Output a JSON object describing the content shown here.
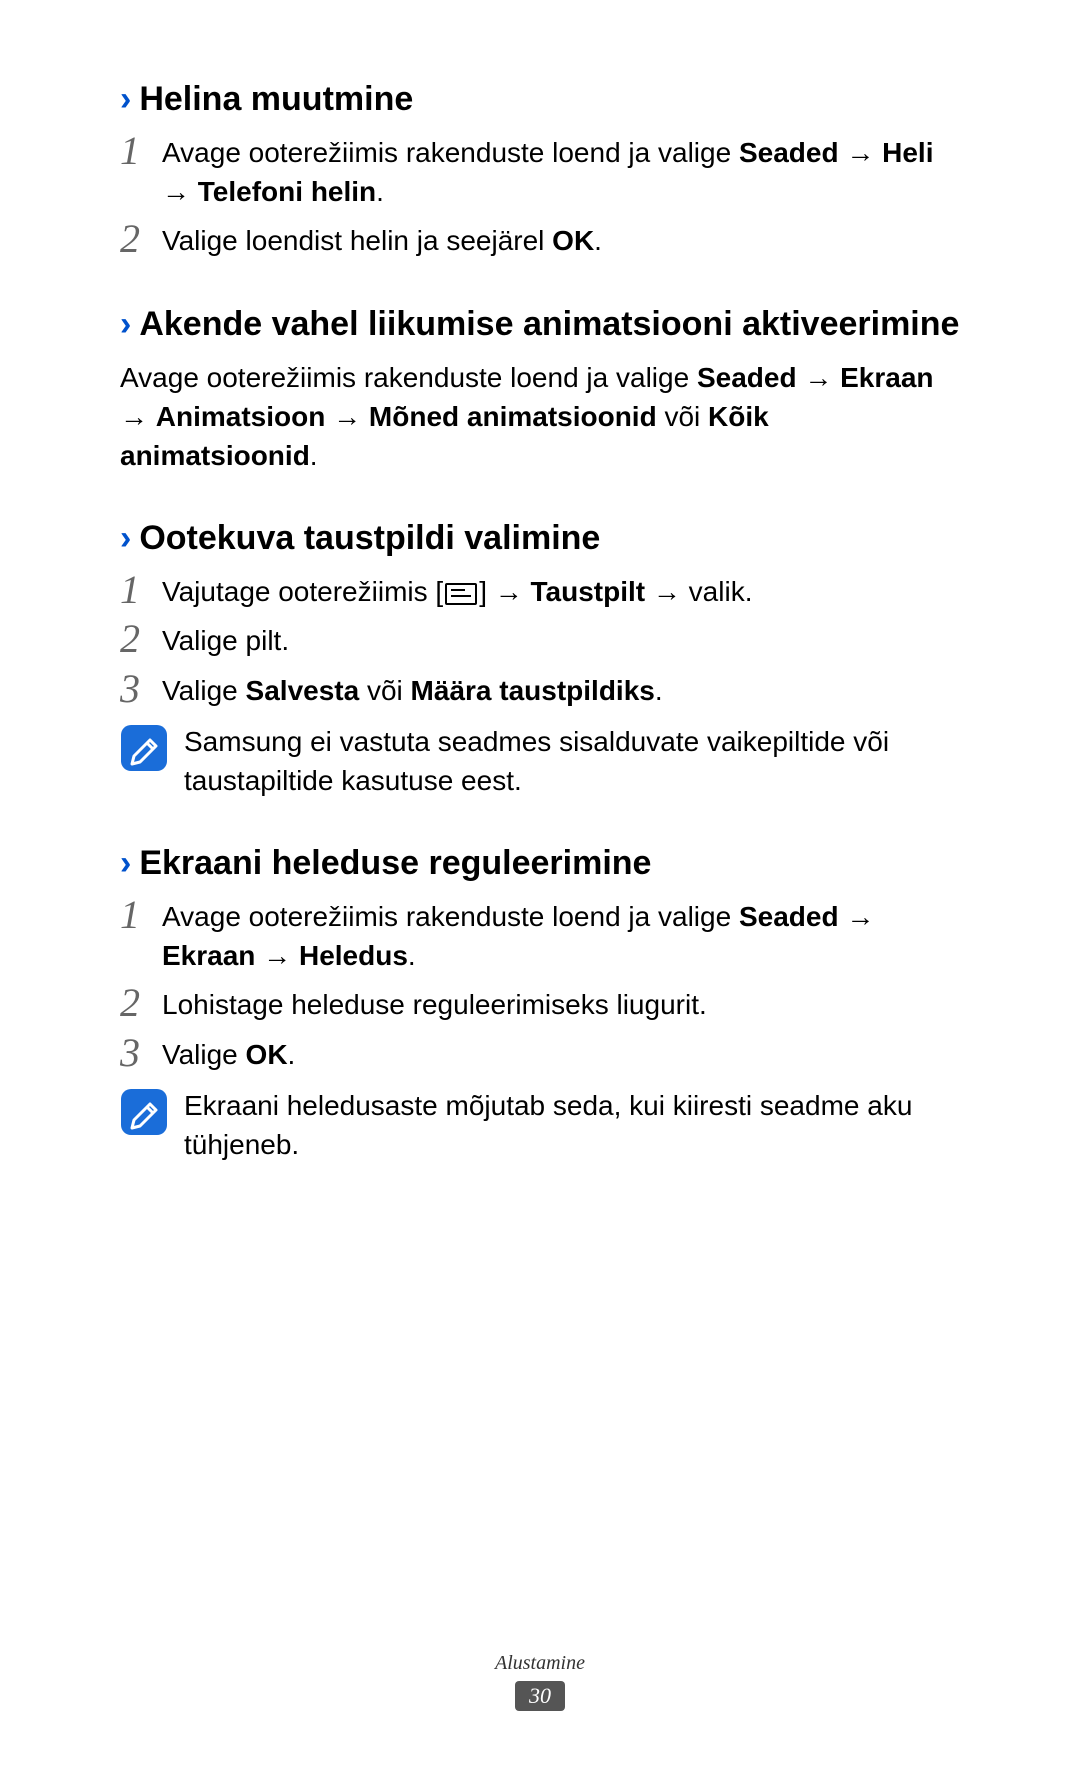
{
  "sections": [
    {
      "heading": "Helina muutmine",
      "items": [
        {
          "num": "1",
          "parts": [
            "Avage ooterežiimis rakenduste loend ja valige ",
            {
              "b": "Seaded"
            },
            " → ",
            {
              "b": "Heli"
            },
            " → ",
            {
              "b": "Telefoni helin"
            },
            "."
          ]
        },
        {
          "num": "2",
          "parts": [
            "Valige loendist helin ja seejärel ",
            {
              "b": "OK"
            },
            "."
          ]
        }
      ]
    },
    {
      "heading": "Akende vahel liikumise animatsiooni aktiveerimine",
      "paragraph_parts": [
        "Avage ooterežiimis rakenduste loend ja valige ",
        {
          "b": "Seaded"
        },
        " → ",
        {
          "b": "Ekraan"
        },
        " → ",
        {
          "b": "Animatsioon"
        },
        " → ",
        {
          "b": "Mõned animatsioonid"
        },
        " või ",
        {
          "b": "Kõik animatsioonid"
        },
        "."
      ]
    },
    {
      "heading": "Ootekuva taustpildi valimine",
      "items": [
        {
          "num": "1",
          "parts": [
            "Vajutage ooterežiimis [",
            {
              "icon": "menu"
            },
            "] → ",
            {
              "b": "Taustpilt"
            },
            " → valik."
          ]
        },
        {
          "num": "2",
          "parts": [
            "Valige pilt."
          ]
        },
        {
          "num": "3",
          "parts": [
            "Valige ",
            {
              "b": "Salvesta"
            },
            " või ",
            {
              "b": "Määra taustpildiks"
            },
            "."
          ]
        }
      ],
      "note": "Samsung ei vastuta seadmes sisalduvate vaikepiltide või taustapiltide kasutuse eest."
    },
    {
      "heading": "Ekraani heleduse reguleerimine",
      "items": [
        {
          "num": "1",
          "parts": [
            "Avage ooterežiimis rakenduste loend ja valige ",
            {
              "b": "Seaded"
            },
            " → ",
            {
              "b": "Ekraan"
            },
            " → ",
            {
              "b": "Heledus"
            },
            "."
          ]
        },
        {
          "num": "2",
          "parts": [
            "Lohistage heleduse reguleerimiseks liugurit."
          ]
        },
        {
          "num": "3",
          "parts": [
            "Valige ",
            {
              "b": "OK"
            },
            "."
          ]
        }
      ],
      "note": "Ekraani heledusaste mõjutab seda, kui kiiresti seadme aku tühjeneb."
    }
  ],
  "footer": {
    "label": "Alustamine",
    "page": "30"
  }
}
